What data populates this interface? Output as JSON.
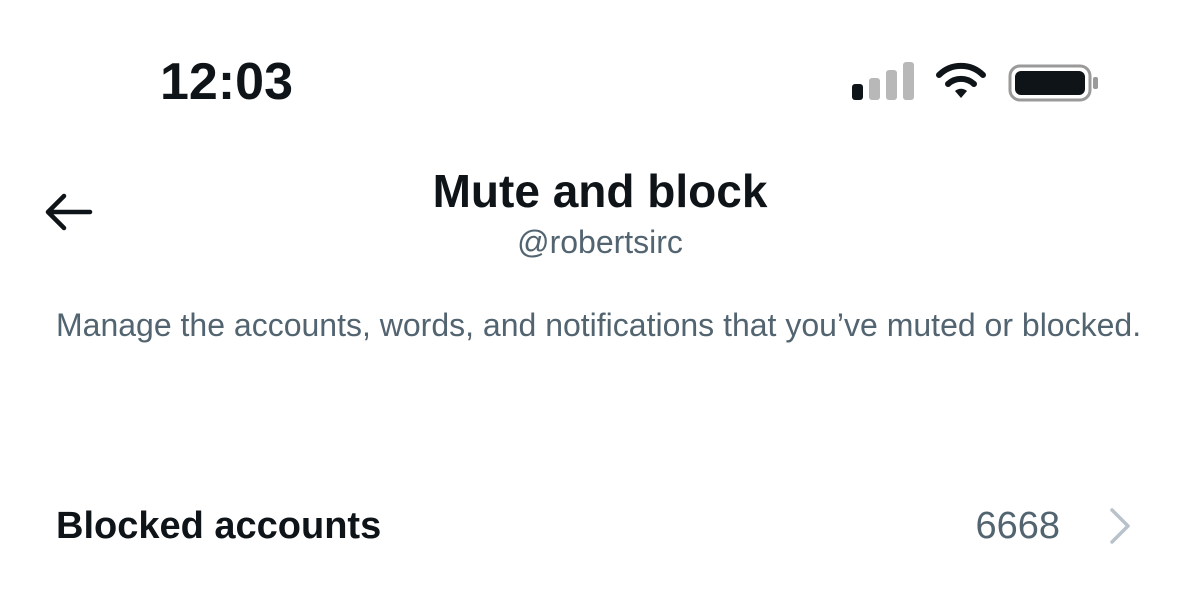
{
  "status_bar": {
    "time": "12:03",
    "signal_icon": "cellular-signal-icon",
    "signal_bars_filled": 1,
    "signal_bars_total": 4,
    "wifi_icon": "wifi-icon",
    "battery_icon": "battery-icon",
    "battery_level": 0.95
  },
  "header": {
    "back_icon": "back-arrow-icon",
    "title": "Mute and block",
    "subtitle": "@robertsirc"
  },
  "description": "Manage the accounts, words, and notifications that you’ve muted or blocked.",
  "rows": [
    {
      "label": "Blocked accounts",
      "count": "6668",
      "chevron_icon": "chevron-right-icon"
    }
  ],
  "colors": {
    "primary_text": "#0f1419",
    "secondary_text": "#536471",
    "chevron": "#b9c2cb",
    "signal_inactive": "#b8b8b8"
  }
}
